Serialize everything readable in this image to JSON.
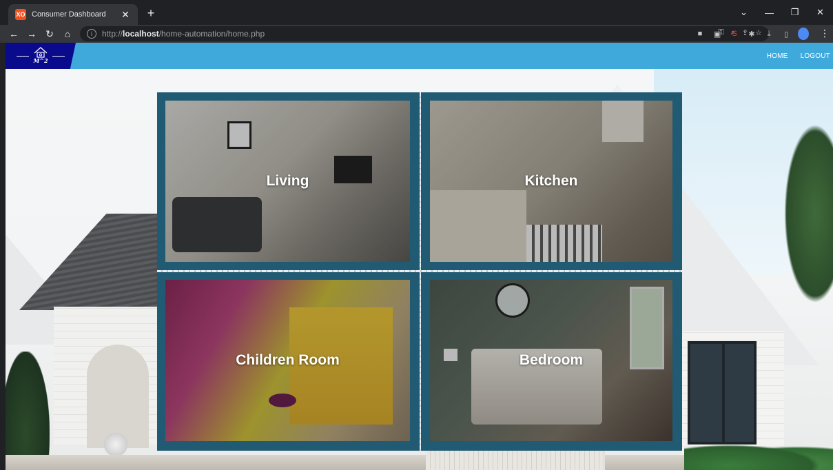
{
  "browser": {
    "tab_title": "Consumer Dashboard",
    "tab_favicon": "XO",
    "url_prefix": "http://",
    "url_host": "localhost",
    "url_path": "/home-automation/home.php"
  },
  "app": {
    "logo_text": "M^2",
    "nav": {
      "home": "HOME",
      "logout": "LOGOUT"
    },
    "colors": {
      "nav_bar": "#3fa9dc",
      "logo_bg": "#0a0a8c",
      "frame": "#205a73"
    }
  },
  "rooms": [
    {
      "label": "Living"
    },
    {
      "label": "Kitchen"
    },
    {
      "label": "Children Room"
    },
    {
      "label": "Bedroom"
    }
  ]
}
